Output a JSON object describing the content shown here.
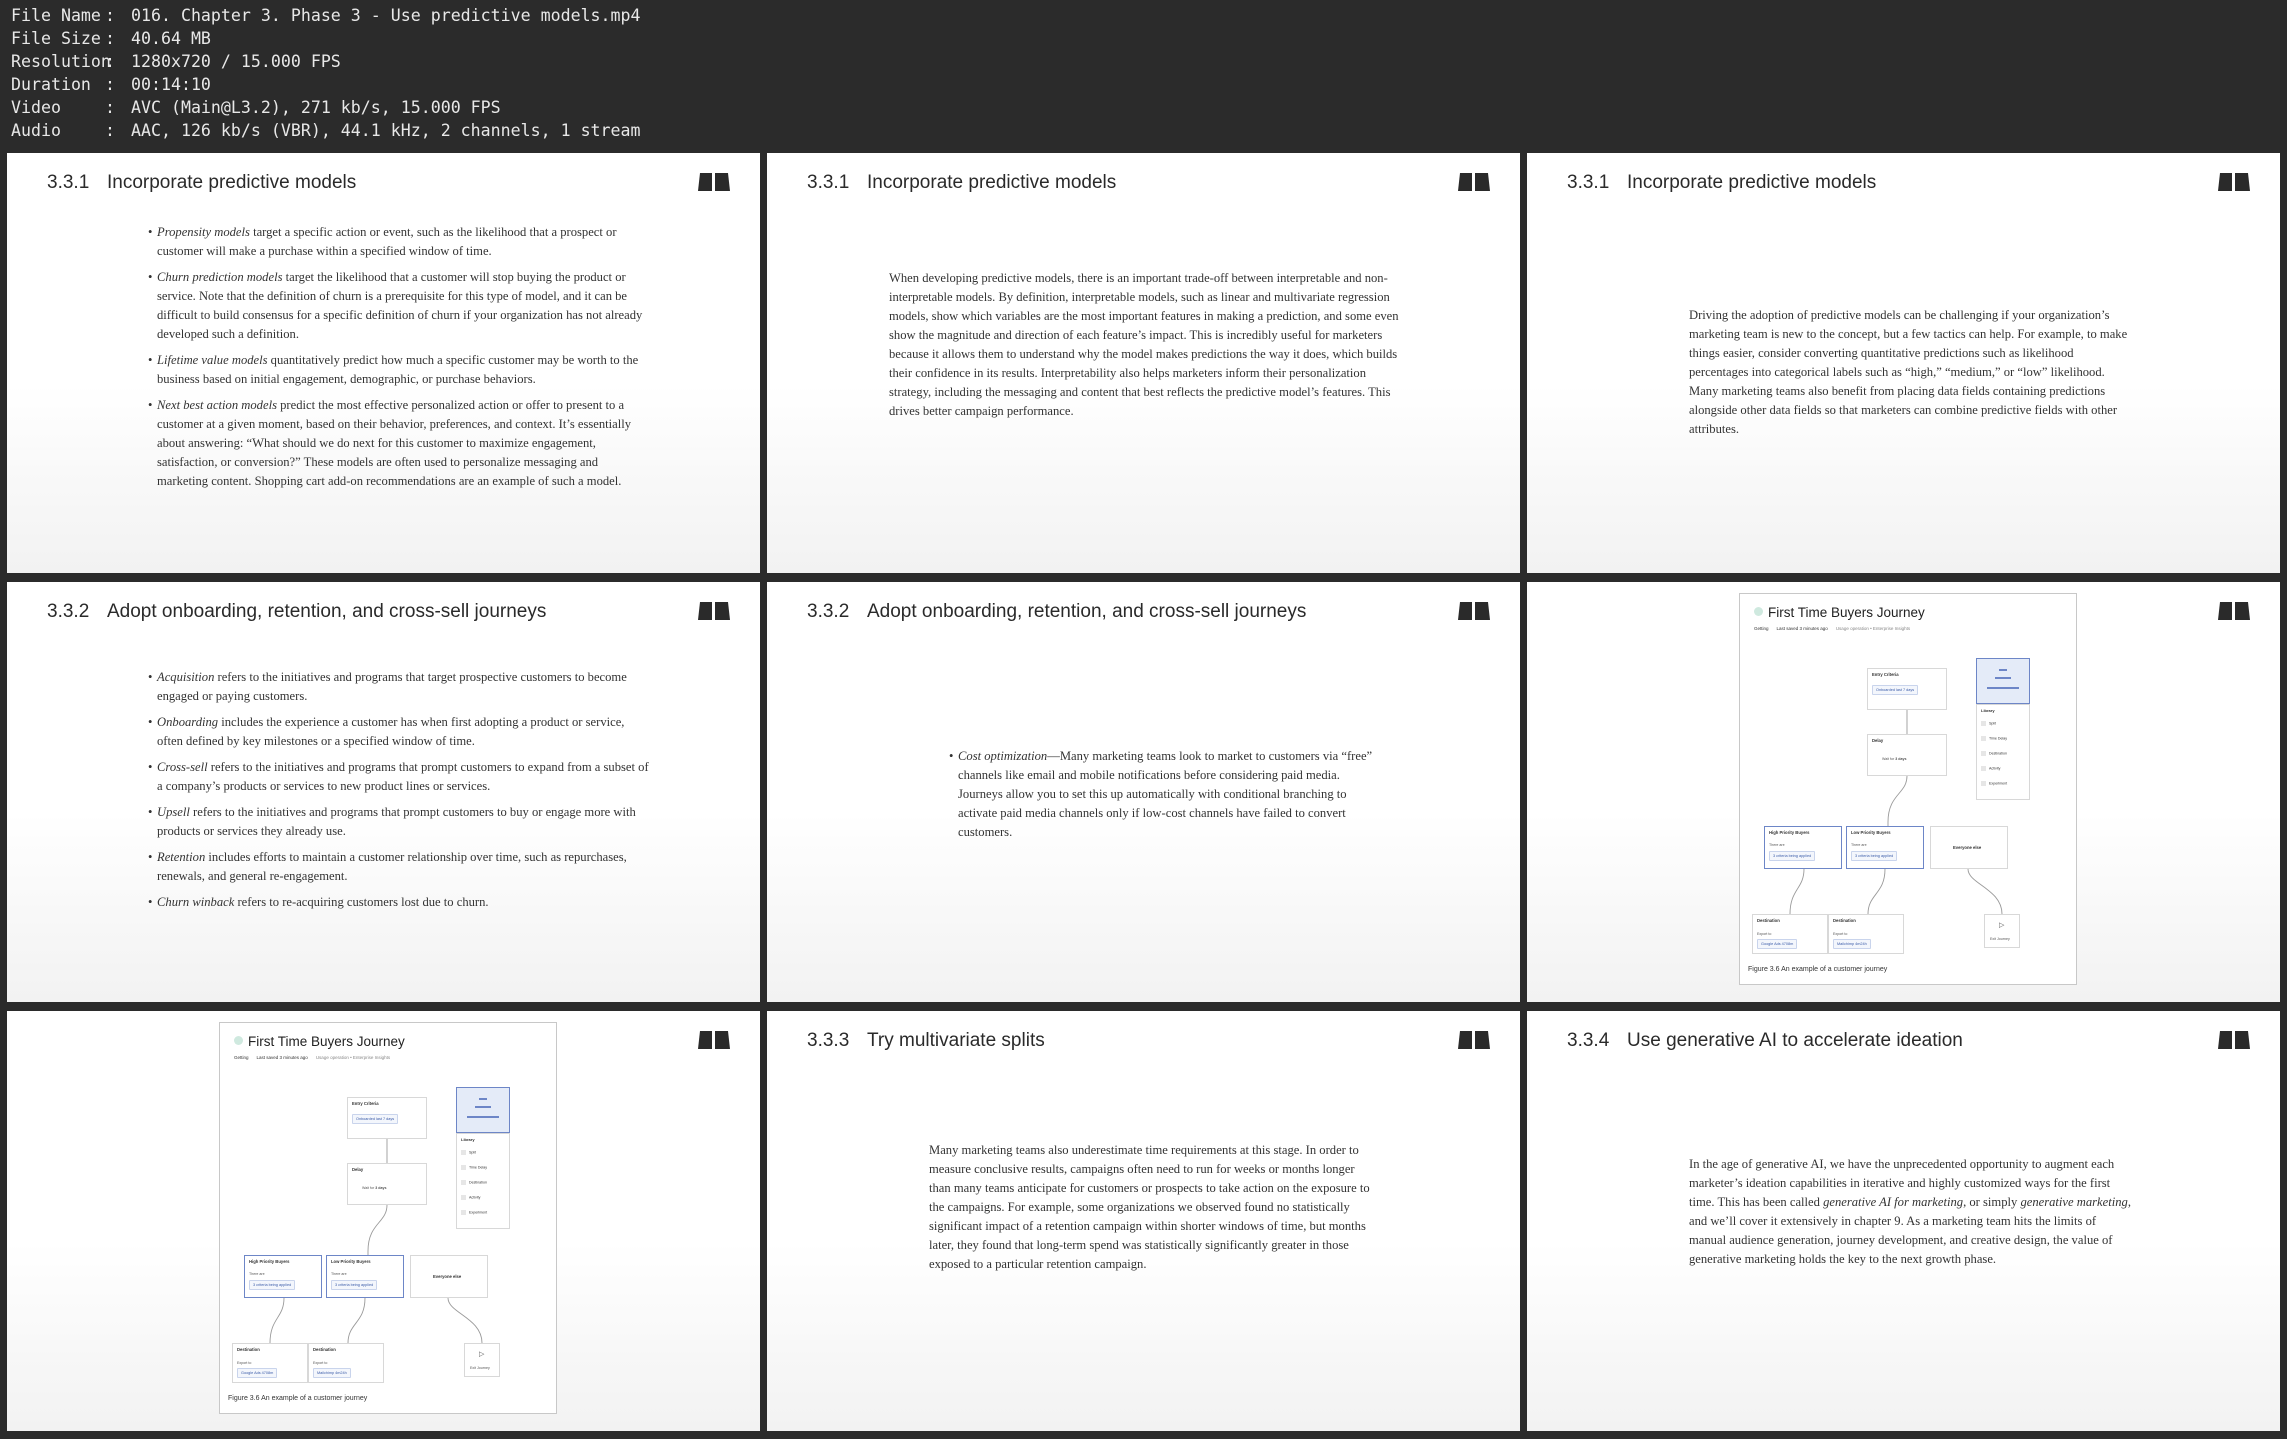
{
  "file_info": [
    {
      "key": "File Name",
      "value": "016. Chapter 3. Phase 3 - Use predictive models.mp4"
    },
    {
      "key": "File Size",
      "value": "40.64 MB"
    },
    {
      "key": "Resolution",
      "value": "1280x720 / 15.000 FPS"
    },
    {
      "key": "Duration",
      "value": "00:14:10"
    },
    {
      "key": "Video",
      "value": "AVC (Main@L3.2), 271 kb/s, 15.000 FPS"
    },
    {
      "key": "Audio",
      "value": "AAC, 126 kb/s (VBR), 44.1 kHz, 2 channels, 1 stream"
    }
  ],
  "separator": ":",
  "slides": {
    "s1": {
      "num": "3.3.1",
      "title": "Incorporate predictive models",
      "bullets": [
        {
          "term": "Propensity models",
          "text": " target a specific action or event, such as the likelihood that a prospect or customer will make a purchase within a specified window of time."
        },
        {
          "term": "Churn prediction models",
          "text": " target the likelihood that a customer will stop buying the product or service. Note that the definition of churn is a prerequisite for this type of model, and it can be difficult to build consensus for a specific definition of churn if your organization has not already developed such a definition."
        },
        {
          "term": "Lifetime value models",
          "text": " quantitatively predict how much a specific customer may be worth to the business based on initial engagement, demographic, or purchase behaviors."
        },
        {
          "term": "Next best action models",
          "text": " predict the most effective personalized action or offer to present to a customer at a given moment, based on their behavior, preferences, and context. It’s essentially about answering: “What should we do next for this customer to maximize engagement, satisfaction, or conversion?” These models are often used to personalize messaging and marketing content. Shopping cart add-on recommendations are an example of such a model."
        }
      ]
    },
    "s2": {
      "num": "3.3.1",
      "title": "Incorporate predictive models",
      "paragraph": "When developing predictive models, there is an important trade-off between interpretable and non-interpretable models. By definition, interpretable models, such as linear and multivariate regression models, show which variables are the most important features in making a prediction, and some even show the magnitude and direction of each feature’s impact. This is incredibly useful for marketers because it allows them to understand why the model makes predictions the way it does, which builds their confidence in its results. Interpretability also helps marketers inform their personalization strategy, including the messaging and content that best reflects the predictive model’s features. This drives better campaign performance."
    },
    "s3": {
      "num": "3.3.1",
      "title": "Incorporate predictive models",
      "paragraph": "Driving the adoption of predictive models can be challenging if your organization’s marketing team is new to the concept, but a few tactics can help. For example, to make things easier, consider converting quantitative predictions such as likelihood percentages into categorical labels such as “high,” “medium,” or “low” likelihood. Many marketing teams also benefit from placing data fields containing predictions alongside other data fields so that marketers can combine predictive fields with other attributes."
    },
    "s4": {
      "num": "3.3.2",
      "title": "Adopt onboarding, retention, and cross-sell journeys",
      "bullets": [
        {
          "term": "Acquisition",
          "text": " refers to the initiatives and programs that target prospective customers to become engaged or paying customers."
        },
        {
          "term": "Onboarding",
          "text": " includes the experience a customer has when first adopting a product or service, often defined by key milestones or a specified window of time."
        },
        {
          "term": "Cross-sell",
          "text": " refers to the initiatives and programs that prompt customers to expand from a subset of a company’s products or services to new product lines or services."
        },
        {
          "term": "Upsell",
          "text": " refers to the initiatives and programs that prompt customers to buy or engage more with products or services they already use."
        },
        {
          "term": "Retention",
          "text": " includes efforts to maintain a customer relationship over time, such as repurchases, renewals, and general re-engagement."
        },
        {
          "term": "Churn winback",
          "text": " refers to re-acquiring customers lost due to churn."
        }
      ]
    },
    "s5": {
      "num": "3.3.2",
      "title": "Adopt onboarding, retention, and cross-sell journeys",
      "bullets": [
        {
          "term": "Cost optimization",
          "text": "—Many marketing teams look to market to customers via “free” channels like email and mobile notifications before considering paid media. Journeys allow you to set this up automatically with conditional branching to activate paid media channels only if low-cost channels have failed to convert customers."
        }
      ]
    },
    "s8": {
      "num": "3.3.3",
      "title": "Try multivariate splits",
      "paragraph": "Many marketing teams also underestimate time requirements at this stage. In order to measure conclusive results, campaigns often need to run for weeks or months longer than many teams anticipate for customers or prospects to take action on the exposure to the campaigns. For example, some organizations we observed found no statistically significant impact of a retention campaign within shorter windows of time, but months later, they found that long-term spend was statistically significantly greater in those exposed to a particular retention campaign."
    },
    "s9": {
      "num": "3.3.4",
      "title": "Use generative AI to accelerate ideation",
      "paragraph_parts": [
        {
          "t": "In the age of generative AI, we have the unprecedented opportunity to augment each marketer’s ideation capabilities in iterative and highly customized ways for the first time. This has been called ",
          "i": false
        },
        {
          "t": "generative AI for marketing",
          "i": true
        },
        {
          "t": ", or simply ",
          "i": false
        },
        {
          "t": "generative marketing",
          "i": true
        },
        {
          "t": ", and we’ll cover it extensively in chapter 9. As a marketing team hits the limits of manual audience generation, journey development, and creative design, the value of generative marketing holds the key to the next growth phase.",
          "i": false
        }
      ]
    }
  },
  "figure": {
    "title": "First Time Buyers Journey",
    "sub_a": "Getting",
    "sub_b": "Last saved 3 minutes ago",
    "sub_c": "Usage operation • Enterprise Insights",
    "entry_criteria": "Entry Criteria",
    "entry_pill": "Onboarded last 7 days",
    "delay": "Delay",
    "wait_label": "Wait for",
    "wait_value": "3 days",
    "library": "Library",
    "library_items": [
      "Split",
      "Time Delay",
      "Destination",
      "Activity",
      "Experiment"
    ],
    "high_priority": "High Priority Buyers",
    "low_priority": "Low Priority Buyers",
    "everyone_else": "Everyone else",
    "there_are": "There are",
    "criteria": "3 criteria being applied",
    "destination": "Destination",
    "export_to": "Export to",
    "google_ads": "Google Ads 4708m",
    "mailchimp": "Mailchimp 4m24h",
    "exit": "Exit Journey",
    "caption": "Figure 3.6 An example of a customer journey"
  },
  "colors": {
    "logo": "#2a2a2a",
    "accent_blue": "#6d86c7",
    "background": "#2b2b2b"
  }
}
